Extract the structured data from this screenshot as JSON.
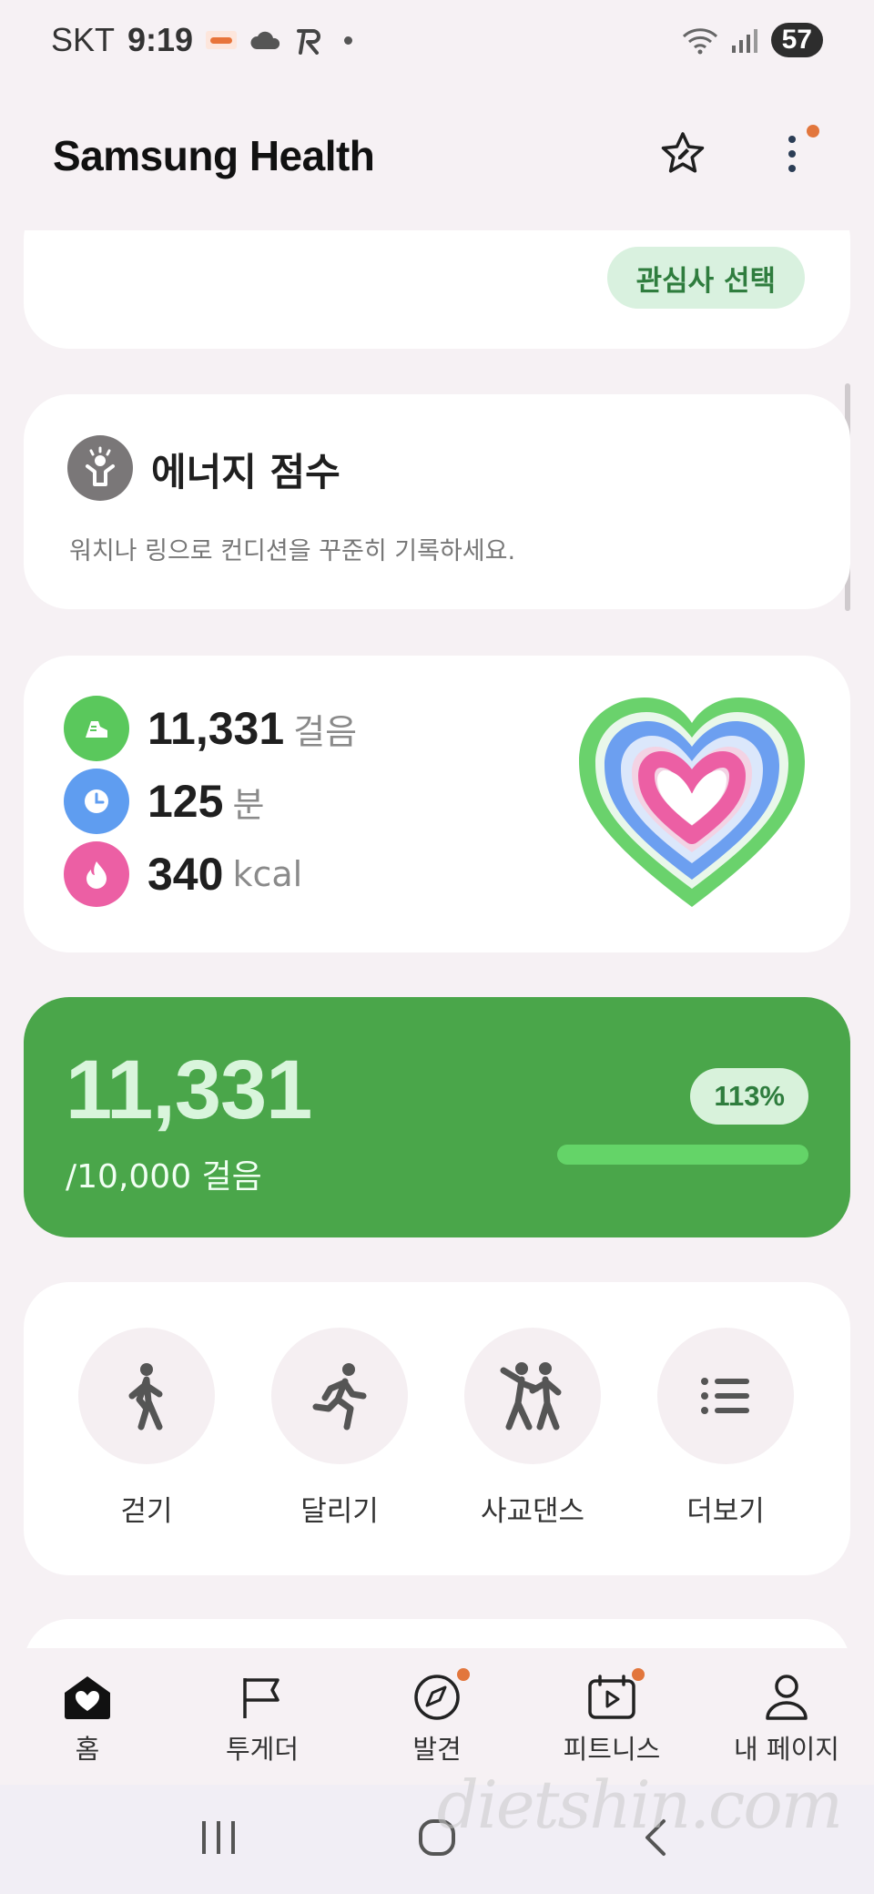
{
  "status_bar": {
    "carrier": "SKT",
    "time": "9:19",
    "battery": "57",
    "notification_icons": [
      "traffic-icon",
      "cloud-icon",
      "app-r-icon"
    ],
    "system_icons": [
      "wifi-icon",
      "signal-icon"
    ]
  },
  "header": {
    "title": "Samsung Health",
    "actions": [
      "star-edit-icon",
      "more-vertical-icon"
    ]
  },
  "interest_card": {
    "button_label": "관심사 선택"
  },
  "energy_card": {
    "title": "에너지 점수",
    "subtitle": "워치나 링으로 컨디션을 꾸준히 기록하세요."
  },
  "activity_summary": {
    "steps_value": "11,331",
    "steps_unit": "걸음",
    "minutes_value": "125",
    "minutes_unit": "분",
    "calories_value": "340",
    "calories_unit": "kcal",
    "colors": {
      "steps": "#5ac85c",
      "minutes": "#5f9df0",
      "calories": "#ec5fa4"
    }
  },
  "steps_card": {
    "value": "11,331",
    "goal_text": "/10,000 걸음",
    "percent": "113%",
    "progress_fraction": 1.0,
    "accent": "#4aa64a"
  },
  "quick_activities": [
    {
      "label": "걷기",
      "icon": "walking-icon"
    },
    {
      "label": "달리기",
      "icon": "running-icon"
    },
    {
      "label": "사교댄스",
      "icon": "dance-icon"
    },
    {
      "label": "더보기",
      "icon": "list-icon"
    }
  ],
  "bottom_nav": [
    {
      "label": "홈",
      "icon": "home-heart-icon",
      "badge": false
    },
    {
      "label": "투게더",
      "icon": "flag-icon",
      "badge": false
    },
    {
      "label": "발견",
      "icon": "compass-icon",
      "badge": true
    },
    {
      "label": "피트니스",
      "icon": "fitness-calendar-icon",
      "badge": true
    },
    {
      "label": "내 페이지",
      "icon": "person-icon",
      "badge": false
    }
  ],
  "watermark": "dietshin.com"
}
